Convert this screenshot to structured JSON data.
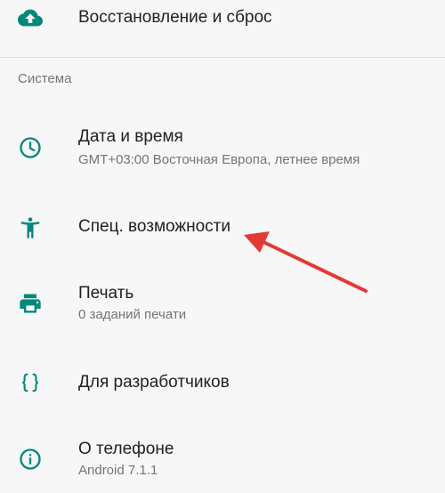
{
  "accent_color": "#00897b",
  "annotation_arrow_color": "#e53935",
  "top_item": {
    "icon": "cloud-upload-icon",
    "title": "Восстановление и сброс"
  },
  "section": {
    "header": "Система"
  },
  "items": [
    {
      "icon": "clock-icon",
      "title": "Дата и время",
      "subtitle": "GMT+03:00 Восточная Европа, летнее время"
    },
    {
      "icon": "accessibility-icon",
      "title": "Спец. возможности"
    },
    {
      "icon": "printer-icon",
      "title": "Печать",
      "subtitle": "0 заданий печати"
    },
    {
      "icon": "braces-icon",
      "title": "Для разработчиков"
    },
    {
      "icon": "info-icon",
      "title": "О телефоне",
      "subtitle": "Android 7.1.1"
    }
  ]
}
